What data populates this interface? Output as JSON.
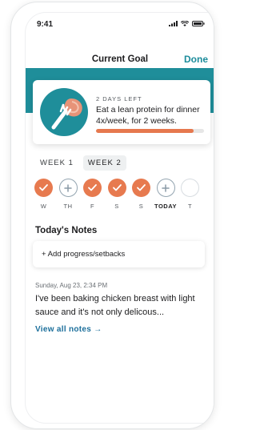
{
  "status_bar": {
    "time": "9:41"
  },
  "nav": {
    "title": "Current Goal",
    "done_label": "Done"
  },
  "goal": {
    "days_left": "2 DAYS LEFT",
    "text": "Eat a lean protein for dinner 4x/week, for 2 weeks.",
    "progress_fraction": 0.9,
    "icon": "fork-with-meat-icon"
  },
  "weeks": [
    {
      "label": "WEEK 1",
      "active": false
    },
    {
      "label": "WEEK 2",
      "active": true
    }
  ],
  "days": [
    {
      "label": "W",
      "state": "done"
    },
    {
      "label": "TH",
      "state": "add"
    },
    {
      "label": "F",
      "state": "done"
    },
    {
      "label": "S",
      "state": "done"
    },
    {
      "label": "S",
      "state": "done"
    },
    {
      "label": "TODAY",
      "state": "add"
    },
    {
      "label": "T",
      "state": "empty"
    }
  ],
  "notes": {
    "title": "Today's Notes",
    "add_label": "+ Add progress/setbacks",
    "latest_date": "Sunday, Aug 23, 2:34 PM",
    "latest_text": "I've been baking chicken breast with light sauce and it's not only delicous...",
    "view_all_label": "View all notes →"
  },
  "colors": {
    "accent_teal": "#1f8e9a",
    "accent_orange": "#e77a4f",
    "link_blue": "#1c6f9b"
  }
}
